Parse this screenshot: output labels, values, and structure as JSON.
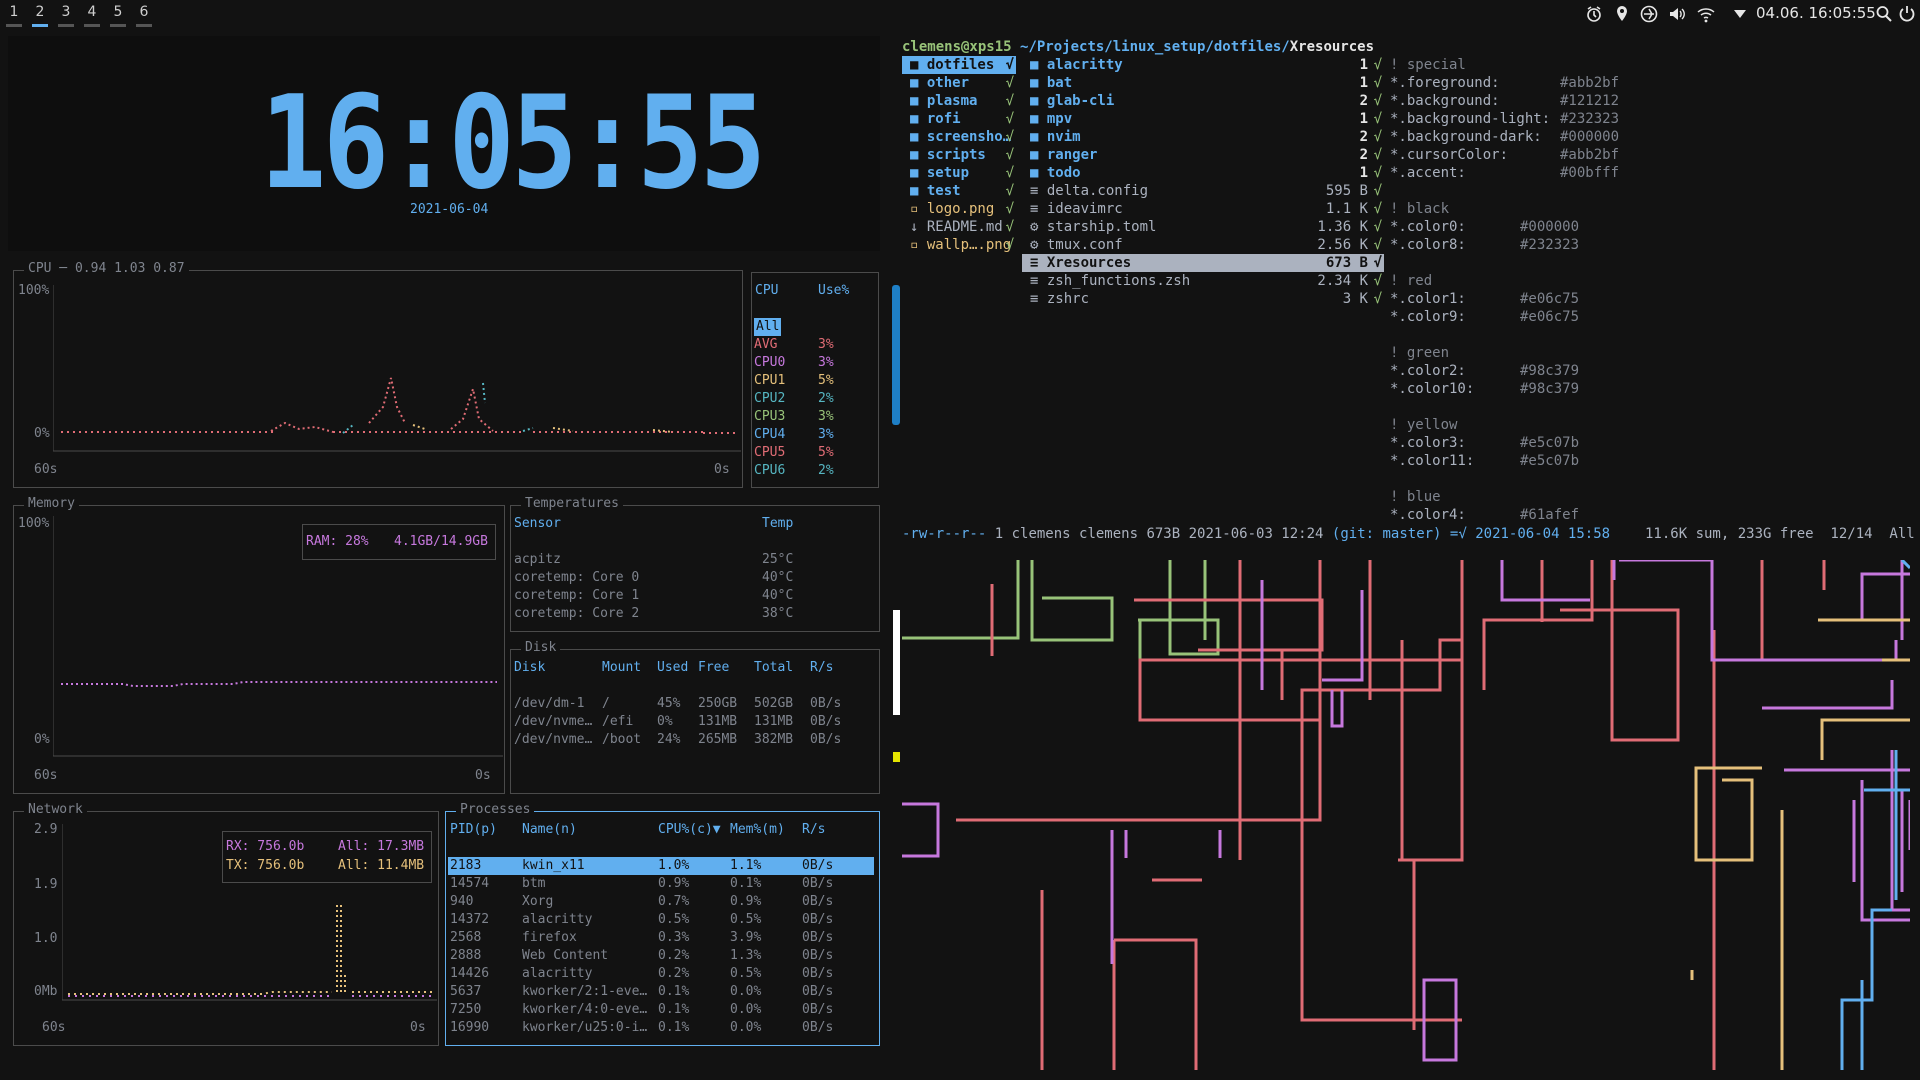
{
  "workspaces": [
    "1",
    "2",
    "3",
    "4",
    "5",
    "6"
  ],
  "active_workspace": "2",
  "tray": {
    "datetime": "04.06. 16:05:55"
  },
  "clock": {
    "time": "16:05:55",
    "date": "2021-06-04"
  },
  "cpu": {
    "title": "CPU",
    "load": "0.94 1.03 0.87",
    "y_top": "100%",
    "y_bottom": "0%",
    "x_left": "60s",
    "x_right": "0s",
    "table_headers": [
      "CPU",
      "Use%"
    ],
    "rows": [
      {
        "name": "All",
        "use": ""
      },
      {
        "name": "AVG",
        "use": "3%"
      },
      {
        "name": "CPU0",
        "use": "3%"
      },
      {
        "name": "CPU1",
        "use": "5%"
      },
      {
        "name": "CPU2",
        "use": "2%"
      },
      {
        "name": "CPU3",
        "use": "3%"
      },
      {
        "name": "CPU4",
        "use": "3%"
      },
      {
        "name": "CPU5",
        "use": "5%"
      },
      {
        "name": "CPU6",
        "use": "2%"
      }
    ]
  },
  "memory": {
    "title": "Memory",
    "y_top": "100%",
    "y_bottom": "0%",
    "x_left": "60s",
    "x_right": "0s",
    "ram_label": "RAM: 28%",
    "ram_value": "4.1GB/14.9GB"
  },
  "temperatures": {
    "title": "Temperatures",
    "headers": [
      "Sensor",
      "Temp"
    ],
    "rows": [
      {
        "sensor": "acpitz",
        "temp": "25°C"
      },
      {
        "sensor": "coretemp: Core 0",
        "temp": "40°C"
      },
      {
        "sensor": "coretemp: Core 1",
        "temp": "40°C"
      },
      {
        "sensor": "coretemp: Core 2",
        "temp": "38°C"
      }
    ]
  },
  "disk": {
    "title": "Disk",
    "headers": [
      "Disk",
      "Mount",
      "Used",
      "Free",
      "Total",
      "R/s"
    ],
    "rows": [
      {
        "disk": "/dev/dm-1",
        "mount": "/",
        "used": "45%",
        "free": "250GB",
        "total": "502GB",
        "rs": "0B/s"
      },
      {
        "disk": "/dev/nvme…",
        "mount": "/efi",
        "used": "0%",
        "free": "131MB",
        "total": "131MB",
        "rs": "0B/s"
      },
      {
        "disk": "/dev/nvme…",
        "mount": "/boot",
        "used": "24%",
        "free": "265MB",
        "total": "382MB",
        "rs": "0B/s"
      }
    ]
  },
  "network": {
    "title": "Network",
    "y_ticks": [
      "2.9",
      "1.9",
      "1.0",
      "0Mb"
    ],
    "x_left": "60s",
    "x_right": "0s",
    "rx": "RX: 756.0b",
    "rx_all": "All: 17.3MB",
    "tx": "TX: 756.0b",
    "tx_all": "All: 11.4MB"
  },
  "processes": {
    "title": "Processes",
    "headers": [
      "PID(p)",
      "Name(n)",
      "CPU%(c)▼",
      "Mem%(m)",
      "R/s"
    ],
    "rows": [
      {
        "pid": "2183",
        "name": "kwin_x11",
        "cpu": "1.0%",
        "mem": "1.1%",
        "rs": "0B/s"
      },
      {
        "pid": "14574",
        "name": "btm",
        "cpu": "0.9%",
        "mem": "0.1%",
        "rs": "0B/s"
      },
      {
        "pid": "940",
        "name": "Xorg",
        "cpu": "0.7%",
        "mem": "0.9%",
        "rs": "0B/s"
      },
      {
        "pid": "14372",
        "name": "alacritty",
        "cpu": "0.5%",
        "mem": "0.5%",
        "rs": "0B/s"
      },
      {
        "pid": "2568",
        "name": "firefox",
        "cpu": "0.3%",
        "mem": "3.9%",
        "rs": "0B/s"
      },
      {
        "pid": "2888",
        "name": "Web Content",
        "cpu": "0.2%",
        "mem": "1.3%",
        "rs": "0B/s"
      },
      {
        "pid": "14426",
        "name": "alacritty",
        "cpu": "0.2%",
        "mem": "0.5%",
        "rs": "0B/s"
      },
      {
        "pid": "5637",
        "name": "kworker/2:1-eve…",
        "cpu": "0.1%",
        "mem": "0.0%",
        "rs": "0B/s"
      },
      {
        "pid": "7250",
        "name": "kworker/4:0-eve…",
        "cpu": "0.1%",
        "mem": "0.0%",
        "rs": "0B/s"
      },
      {
        "pid": "16990",
        "name": "kworker/u25:0-i…",
        "cpu": "0.1%",
        "mem": "0.0%",
        "rs": "0B/s"
      }
    ]
  },
  "ranger": {
    "prompt_user": "clemens@xps15",
    "prompt_path": "~/Projects/linux_setup/dotfiles/",
    "prompt_file": "Xresources",
    "left_col": [
      {
        "name": "dotfiles",
        "flag": "√"
      },
      {
        "name": "other",
        "flag": "√"
      },
      {
        "name": "plasma",
        "flag": "√"
      },
      {
        "name": "rofi",
        "flag": "√"
      },
      {
        "name": "screensho…",
        "flag": "√"
      },
      {
        "name": "scripts",
        "flag": "√"
      },
      {
        "name": "setup",
        "flag": "√"
      },
      {
        "name": "test",
        "flag": "√"
      },
      {
        "name": "logo.png",
        "flag": "√"
      },
      {
        "name": "README.md",
        "flag": "√"
      },
      {
        "name": "wallp….png",
        "flag": "√"
      }
    ],
    "mid_col": [
      {
        "name": "alacritty",
        "size": "1",
        "flag": "√"
      },
      {
        "name": "bat",
        "size": "1",
        "flag": "√"
      },
      {
        "name": "glab-cli",
        "size": "2",
        "flag": "√"
      },
      {
        "name": "mpv",
        "size": "1",
        "flag": "√"
      },
      {
        "name": "nvim",
        "size": "2",
        "flag": "√"
      },
      {
        "name": "ranger",
        "size": "2",
        "flag": "√"
      },
      {
        "name": "todo",
        "size": "1",
        "flag": "√"
      },
      {
        "name": "delta.config",
        "size": "595 B",
        "flag": "√"
      },
      {
        "name": "ideavimrc",
        "size": "1.1 K",
        "flag": "√"
      },
      {
        "name": "starship.toml",
        "size": "1.36 K",
        "flag": "√"
      },
      {
        "name": "tmux.conf",
        "size": "2.56 K",
        "flag": "√"
      },
      {
        "name": "Xresources",
        "size": "673 B",
        "flag": "√"
      },
      {
        "name": "zsh_functions.zsh",
        "size": "2.34 K",
        "flag": "√"
      },
      {
        "name": "zshrc",
        "size": "3 K",
        "flag": "√"
      }
    ],
    "preview": [
      {
        "k": "! special",
        "v": ""
      },
      {
        "k": "*.foreground:",
        "v": "#abb2bf"
      },
      {
        "k": "*.background:",
        "v": "#121212"
      },
      {
        "k": "*.background-light:",
        "v": "#232323"
      },
      {
        "k": "*.background-dark:",
        "v": "#000000"
      },
      {
        "k": "*.cursorColor:",
        "v": "#abb2bf"
      },
      {
        "k": "*.accent:",
        "v": "#00bfff"
      },
      {
        "k": "",
        "v": ""
      },
      {
        "k": "! black",
        "v": ""
      },
      {
        "k": "*.color0:",
        "v": "#000000"
      },
      {
        "k": "*.color8:",
        "v": "#232323"
      },
      {
        "k": "",
        "v": ""
      },
      {
        "k": "! red",
        "v": ""
      },
      {
        "k": "*.color1:",
        "v": "#e06c75"
      },
      {
        "k": "*.color9:",
        "v": "#e06c75"
      },
      {
        "k": "",
        "v": ""
      },
      {
        "k": "! green",
        "v": ""
      },
      {
        "k": "*.color2:",
        "v": "#98c379"
      },
      {
        "k": "*.color10:",
        "v": "#98c379"
      },
      {
        "k": "",
        "v": ""
      },
      {
        "k": "! yellow",
        "v": ""
      },
      {
        "k": "*.color3:",
        "v": "#e5c07b"
      },
      {
        "k": "*.color11:",
        "v": "#e5c07b"
      },
      {
        "k": "",
        "v": ""
      },
      {
        "k": "! blue",
        "v": ""
      },
      {
        "k": "*.color4:",
        "v": "#61afef"
      }
    ],
    "status_perms": "-rw-r--r--",
    "status_info": "1 clemens clemens 673B 2021-06-03 12:24",
    "status_git": "(git: master)",
    "status_date": "=√ 2021-06-04 15:58",
    "status_right": "11.6K sum, 233G free  12/14  All"
  },
  "colors": {
    "accent": "#61afef",
    "red": "#e06c75",
    "green": "#98c379",
    "yellow": "#e5c07b",
    "purple": "#c678dd",
    "cyan": "#56b6c2"
  }
}
